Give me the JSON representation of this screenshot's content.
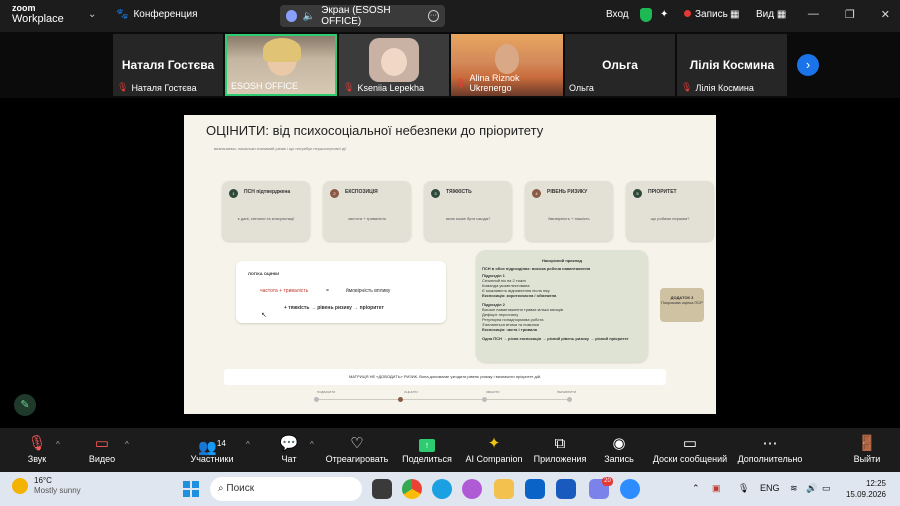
{
  "topbar": {
    "logo_line1": "zoom",
    "logo_line2": "Workplace",
    "meeting_label": "Конференция",
    "screen_share_label": "Экран (ESOSH OFFICE)",
    "signin_label": "Вход",
    "record_label": "Запись",
    "view_label": "Вид"
  },
  "participants": [
    {
      "big_name": "Наталя Гостєва",
      "label": "Наталя Гостєва",
      "muted": true
    },
    {
      "big_name": "",
      "label": "ESOSH OFFICE",
      "muted": false
    },
    {
      "big_name": "",
      "label": "Kseniia Lepekha",
      "muted": true
    },
    {
      "big_name": "",
      "label": "Alina Riznok Ukrenergo",
      "muted": true
    },
    {
      "big_name": "Ольга",
      "label": "Ольга",
      "muted": false
    },
    {
      "big_name": "Лілія Космина",
      "label": "Лілія Космина",
      "muted": true
    }
  ],
  "slide": {
    "title": "ОЦІНИТИ: від психосоціальної небезпеки до пріоритету",
    "subtitle": "визначаємо, наскільки значимий ризик і що потребує першочергової дії",
    "steps": [
      {
        "num": "1",
        "title": "ПСН підтверджена",
        "desc": "є дані, сигнали та консультації",
        "color": "#2f4a3a"
      },
      {
        "num": "2",
        "title": "ЕКСПОЗИЦІЯ",
        "desc": "частота + тривалість",
        "color": "#8a5a44"
      },
      {
        "num": "3",
        "title": "ТЯЖКІСТЬ",
        "desc": "якою може бути шкода?",
        "color": "#2f4a3a"
      },
      {
        "num": "4",
        "title": "РІВЕНЬ РИЗИКУ",
        "desc": "ймовірність + тяжкість",
        "color": "#8a5a44"
      },
      {
        "num": "5",
        "title": "ПРІОРИТЕТ",
        "desc": "що робимо першим?",
        "color": "#2f4a3a"
      }
    ],
    "logic": {
      "heading": "ЛОГІКА ОЦІНКИ",
      "formula_left": "частота + тривалість",
      "equals": "=",
      "formula_right": "ймовірність впливу",
      "chain": "+ тяжкість → рівень ризику → пріоритет"
    },
    "example": {
      "heading": "Наскрізний приклад",
      "intro": "ПСН в обох підрозділах: висока робоча навантаження",
      "lines": [
        {
          "text": "Підрозділ 1",
          "bold": true
        },
        {
          "text": "Сезонний пік на 2 тижні",
          "bold": false
        },
        {
          "text": "Команда укомплектована",
          "bold": false
        },
        {
          "text": "Є можливість відновлення після піку",
          "bold": false
        },
        {
          "text": "Експозиція: короткочасна / обмежена",
          "bold": true
        },
        {
          "text": "",
          "bold": false
        },
        {
          "text": "Підрозділ 2",
          "bold": true
        },
        {
          "text": "Високе навантаження триває кілька місяців",
          "bold": false
        },
        {
          "text": "Дефіцит персоналу",
          "bold": false
        },
        {
          "text": "Регулярна понаднормова робота",
          "bold": false
        },
        {
          "text": "З'являються втома та помилки",
          "bold": false
        },
        {
          "text": "Експозиція: часта і тривала",
          "bold": true
        }
      ],
      "footer": "Одна ПСН → різна експозиція → різний рівень ризику → різний пріоритет"
    },
    "appendix": {
      "line1": "ДОДАТОК 3",
      "line2": "Покрокова оцінка ПСР"
    },
    "matrix_note": "МАТРИЦЯ НЕ «ДОВОДИТЬ» РИЗИК. Вона допомагає узгодити рівень ризику і визначити пріоритет дій.",
    "timeline": [
      "ПОДБАЧИТИ",
      "ОЦІНИТИ",
      "ЗМІНИТИ",
      "ПЕРЕВІРИТИ"
    ]
  },
  "toolbar": {
    "audio_label": "Звук",
    "video_label": "Видео",
    "participants_label": "Участники",
    "participants_count": "14",
    "chat_label": "Чат",
    "react_label": "Отреагировать",
    "share_label": "Поделиться",
    "ai_label": "AI Companion",
    "apps_label": "Приложения",
    "record_label": "Запись",
    "whiteboard_label": "Доски сообщений",
    "more_label": "Дополнительно",
    "leave_label": "Выйти"
  },
  "taskbar": {
    "temperature": "16°C",
    "weather": "Mostly sunny",
    "search_placeholder": "Поиск",
    "language": "ENG",
    "time": "12:25",
    "date": "15.09.2026",
    "badge": "20"
  }
}
